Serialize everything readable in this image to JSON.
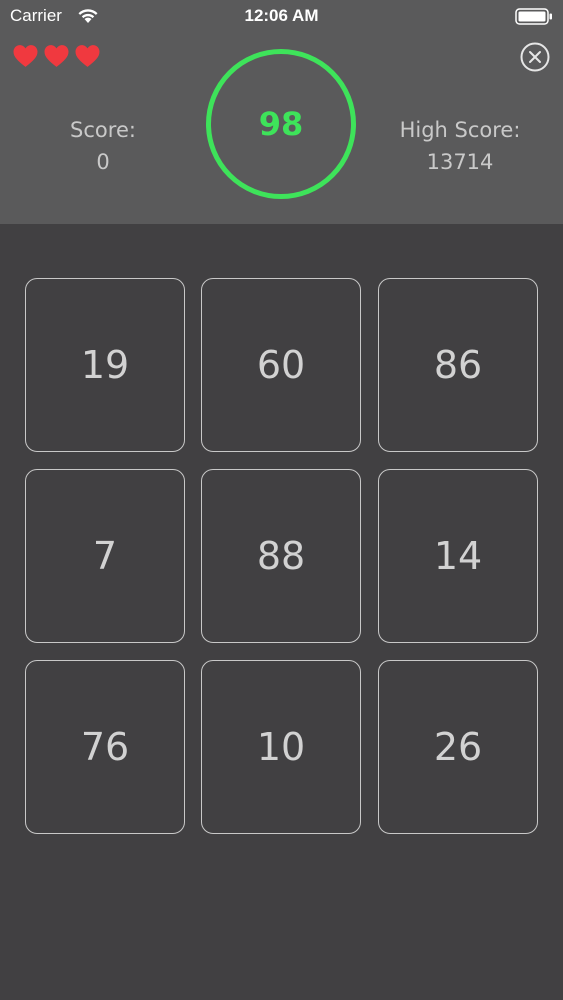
{
  "status_bar": {
    "carrier": "Carrier",
    "time": "12:06 AM"
  },
  "lives": {
    "count": 3,
    "icon": "heart-icon",
    "color": "#f0393f"
  },
  "score": {
    "label": "Score:",
    "value": "0"
  },
  "high_score": {
    "label": "High Score:",
    "value": "13714"
  },
  "timer": {
    "value": "98",
    "color": "#3ee35a"
  },
  "close": {
    "icon": "close-icon"
  },
  "grid": {
    "tiles": [
      "19",
      "60",
      "86",
      "7",
      "88",
      "14",
      "76",
      "10",
      "26"
    ]
  },
  "colors": {
    "header_bg": "#5a5a5b",
    "board_bg": "#414042",
    "tile_border": "#c8c8c8",
    "text": "#d2d2d2"
  }
}
